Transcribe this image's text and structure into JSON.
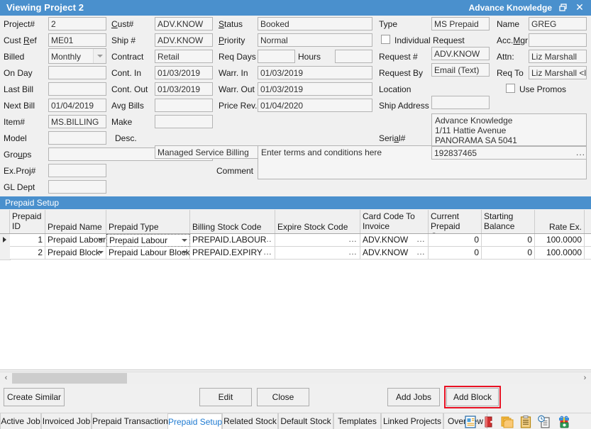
{
  "titlebar": {
    "title": "Viewing Project 2",
    "company": "Advance Knowledge",
    "restore_icon": "restore-icon",
    "close_icon": "close-icon"
  },
  "form": {
    "col1": [
      {
        "label": "Project#",
        "value": "2",
        "type": "text"
      },
      {
        "label": "Cust Ref",
        "value": "ME01",
        "type": "text",
        "accel": "R"
      },
      {
        "label": "Billed",
        "value": "Monthly",
        "type": "combo"
      },
      {
        "label": "On Day",
        "value": "",
        "type": "text"
      },
      {
        "label": "Last Bill",
        "value": "",
        "type": "text"
      },
      {
        "label": "Next Bill",
        "value": "01/04/2019",
        "type": "text"
      },
      {
        "label": "Item#",
        "value": "MS.BILLING",
        "type": "text"
      },
      {
        "label": "Model",
        "value": "",
        "type": "text"
      },
      {
        "label": "Groups",
        "value": "",
        "type": "text",
        "accel": "u"
      },
      {
        "label": "Ex.Proj#",
        "value": "",
        "type": "text"
      },
      {
        "label": "GL Dept",
        "value": "",
        "type": "text"
      }
    ],
    "col2": [
      {
        "label": "Cust#",
        "value": "ADV.KNOW",
        "accel": "C"
      },
      {
        "label": "Ship #",
        "value": "ADV.KNOW"
      },
      {
        "label": "Contract",
        "value": "Retail"
      },
      {
        "label": "Cont. In",
        "value": "01/03/2019"
      },
      {
        "label": "Cont. Out",
        "value": "01/03/2019"
      },
      {
        "label": "Avg Bills",
        "value": "",
        "accel": "g"
      },
      {
        "label": "Make",
        "value": ""
      },
      {
        "label": "Desc.",
        "value": "Managed Service Billing"
      }
    ],
    "col3": [
      {
        "label": "Status",
        "value": "Booked",
        "accel": "S"
      },
      {
        "label": "Priority",
        "value": "Normal",
        "accel": "P"
      },
      {
        "label": "Req Days",
        "value": ""
      },
      {
        "label": "Warr. In",
        "value": "01/03/2019"
      },
      {
        "label": "Warr. Out",
        "value": "01/03/2019"
      },
      {
        "label": "Price Rev.",
        "value": "01/04/2020"
      }
    ],
    "hours": {
      "label": "Hours",
      "value": ""
    },
    "comment": {
      "label": "Comment",
      "value": "Enter terms and conditions here"
    },
    "col4": [
      {
        "label": "Type",
        "value": "MS Prepaid"
      },
      {
        "label": "Request #",
        "value": "ADV.KNOW"
      },
      {
        "label": "Request By",
        "value": "Email (Text)"
      },
      {
        "label": "Location",
        "value": ""
      }
    ],
    "col5": [
      {
        "label": "Name",
        "value": "GREG"
      },
      {
        "label": "Acc.Mgr",
        "value": "",
        "accel": "M"
      },
      {
        "label": "Attn:",
        "value": "Liz Marshall"
      },
      {
        "label": "Req To",
        "value": "Liz Marshall <liz@"
      }
    ],
    "checkboxes": [
      {
        "label": "Individual Request",
        "checked": false
      },
      {
        "label": "Use Promos",
        "checked": false
      }
    ],
    "ship_address": {
      "label": "Ship Address",
      "value": "Advance Knowledge\n1/11 Hattie Avenue\nPANORAMA SA 5041"
    },
    "serial": {
      "label": "Serial#",
      "value": "192837465",
      "accel": "a",
      "ellipsis": "..."
    }
  },
  "section": {
    "title": "Prepaid Setup"
  },
  "grid": {
    "columns": [
      "Prepaid ID",
      "Prepaid Name",
      "Prepaid Type",
      "Billing Stock Code",
      "Expire Stock Code",
      "Card Code To Invoice",
      "Current Prepaid Count",
      "Starting Balance",
      "Rate Ex."
    ],
    "rows": [
      {
        "selected": true,
        "prepaid_id": "1",
        "prepaid_name": "Prepaid Labour",
        "prepaid_type": "Prepaid Labour",
        "billing_stock_code": "PREPAID.LABOUR",
        "expire_stock_code": "",
        "card_code_to_invoice": "ADV.KNOW",
        "current_prepaid_count": "0",
        "starting_balance": "0",
        "rate_ex": "100.0000"
      },
      {
        "selected": false,
        "prepaid_id": "2",
        "prepaid_name": "Prepaid Block",
        "prepaid_type": "Prepaid Labour Block",
        "billing_stock_code": "PREPAID.EXPIRY",
        "expire_stock_code": "",
        "card_code_to_invoice": "ADV.KNOW",
        "current_prepaid_count": "0",
        "starting_balance": "0",
        "rate_ex": "100.0000"
      }
    ],
    "ellipsis": "..."
  },
  "scrollbar": {
    "left_arrow": "‹",
    "right_arrow": "›"
  },
  "buttons": {
    "create_similar": "Create Similar",
    "edit": "Edit",
    "close": "Close",
    "add_jobs": "Add Jobs",
    "add_block": "Add Block",
    "highlight_color": "#e81123"
  },
  "tabs": {
    "items": [
      {
        "label": "Active Job",
        "active": false
      },
      {
        "label": "Invoiced Job",
        "active": false
      },
      {
        "label": "Prepaid Transactions",
        "active": false
      },
      {
        "label": "Prepaid Setup",
        "active": true
      },
      {
        "label": "Related Stock",
        "active": false
      },
      {
        "label": "Default Stock",
        "active": false
      },
      {
        "label": "Templates",
        "active": false
      },
      {
        "label": "Linked Projects",
        "active": false
      },
      {
        "label": "Overview",
        "active": false
      }
    ],
    "icons": [
      "document-details-icon",
      "red-folder-icon",
      "copy-pages-icon",
      "clipboard-icon",
      "clipboard-clock-icon",
      "gift-money-icon"
    ],
    "active_color": "#1e7ad1"
  }
}
